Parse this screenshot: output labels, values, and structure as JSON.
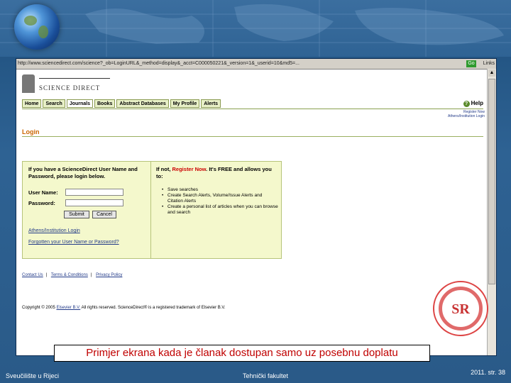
{
  "browser": {
    "address": "http://www.sciencedirect.com/science?_ob=LoginURL&_method=display&_acct=C000050221&_version=1&_userid=10&md5=...",
    "go_label": "Go",
    "links_label": "Links"
  },
  "site": {
    "logo_text": "SCIENCE DIRECT",
    "nav": [
      "Home",
      "Search",
      "Journals",
      "Books",
      "Abstract Databases",
      "My Profile",
      "Alerts"
    ],
    "help": "Help",
    "top_links": [
      "Register Now",
      "Athens/Institution Login"
    ]
  },
  "login": {
    "title": "Login",
    "intro": "If you have a ScienceDirect User Name and Password, please login below.",
    "username_label": "User Name:",
    "password_label": "Password:",
    "submit_label": "Submit",
    "cancel_label": "Cancel",
    "athens_link": "Athens/Institution Login",
    "forgot_link": "Forgotten your User Name or Password?",
    "not_prefix": "If not,",
    "register_link": "Register Now",
    "not_suffix": ". It's FREE and allows you to:",
    "benefits": [
      "Save searches",
      "Create Search Alerts, Volume/Issue Alerts and Citation Alerts",
      "Create a personal list of articles when you can browse and search"
    ]
  },
  "footer_links": [
    "Contact Us",
    "Terms & Conditions",
    "Privacy Policy"
  ],
  "copyright": {
    "prefix": "Copyright © 2005",
    "link": "Elsevier B.V.",
    "suffix": "All rights reserved. ScienceDirect® is a registered trademark of Elsevier B.V."
  },
  "caption": "Primjer ekrana kada je članak dostupan samo uz posebnu doplatu",
  "slide_footer": {
    "left": "Sveučilište u Rijeci",
    "center": "Tehnički fakultet",
    "right": "2011.  str. 38"
  },
  "colors": {
    "caption_red": "#c00000",
    "login_orange": "#cc6600",
    "panel_bg": "#f4f8cc",
    "slide_blue": "#2e6293"
  }
}
